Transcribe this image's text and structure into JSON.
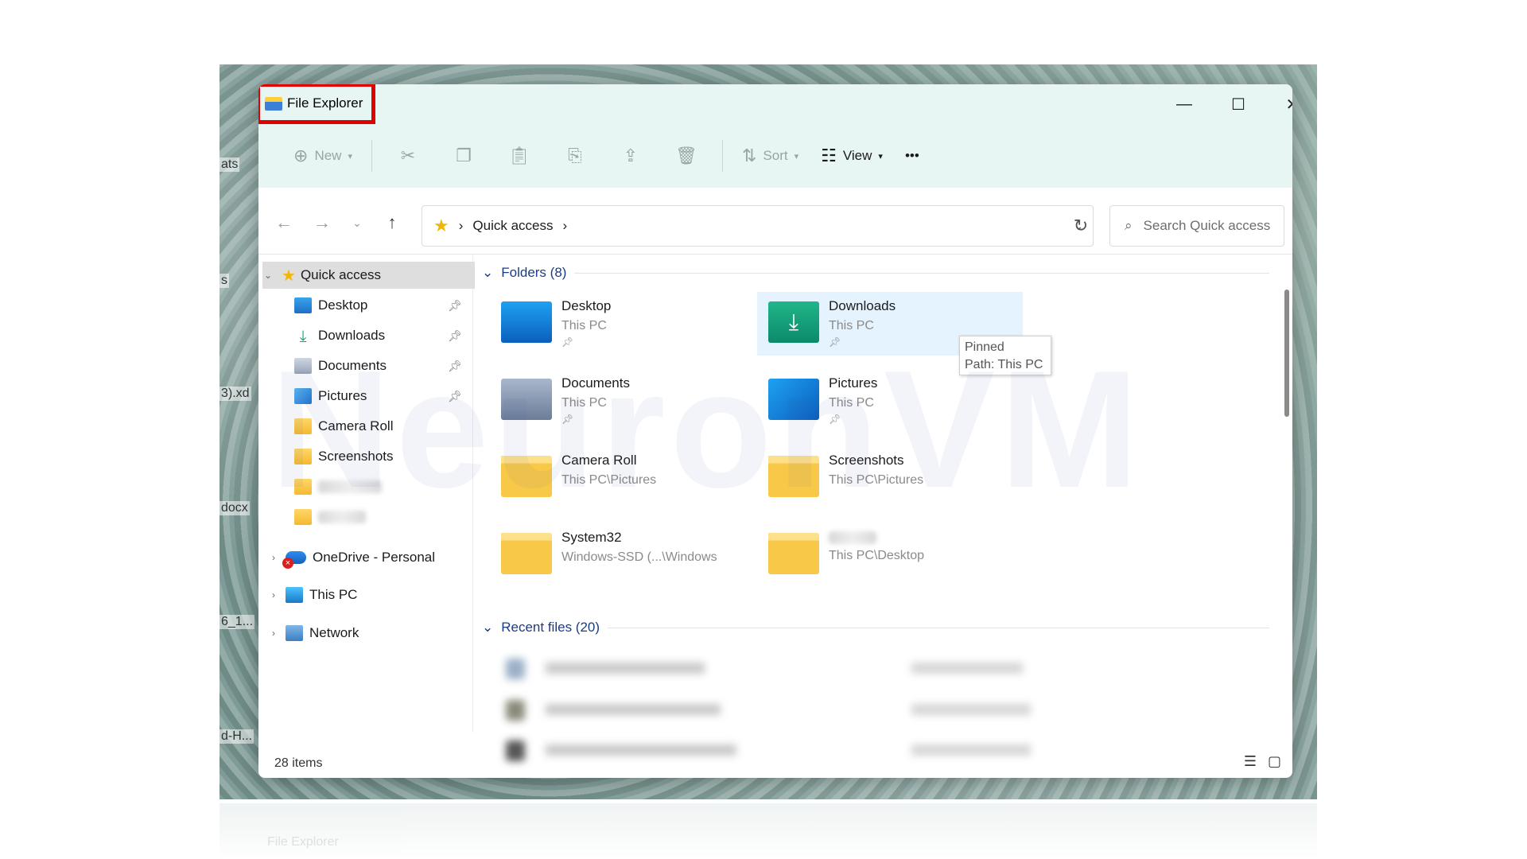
{
  "window": {
    "title": "File Explorer",
    "controls": {
      "minimize": "—",
      "maximize": "☐",
      "close": "✕"
    }
  },
  "toolbar": {
    "new_label": "New",
    "sort_label": "Sort",
    "view_label": "View",
    "more_label": "•••"
  },
  "address": {
    "path_label": "Quick access",
    "search_placeholder": "Search Quick access"
  },
  "sidebar": {
    "quick_access": "Quick access",
    "items": [
      {
        "label": "Desktop",
        "pinned": true
      },
      {
        "label": "Downloads",
        "pinned": true
      },
      {
        "label": "Documents",
        "pinned": true
      },
      {
        "label": "Pictures",
        "pinned": true
      },
      {
        "label": "Camera Roll",
        "pinned": false
      },
      {
        "label": "Screenshots",
        "pinned": false
      }
    ],
    "onedrive": "OneDrive - Personal",
    "this_pc": "This PC",
    "network": "Network"
  },
  "folders_section": {
    "header": "Folders (8)",
    "tiles": [
      {
        "name": "Desktop",
        "location": "This PC",
        "pinned": true
      },
      {
        "name": "Downloads",
        "location": "This PC",
        "pinned": true
      },
      {
        "name": "Documents",
        "location": "This PC",
        "pinned": true
      },
      {
        "name": "Pictures",
        "location": "This PC",
        "pinned": true
      },
      {
        "name": "Camera Roll",
        "location": "This PC\\Pictures"
      },
      {
        "name": "Screenshots",
        "location": "This PC\\Pictures"
      },
      {
        "name": "System32",
        "location": "Windows-SSD (...\\Windows"
      },
      {
        "name": "",
        "location": "This PC\\Desktop"
      }
    ]
  },
  "tooltip": {
    "line1": "Pinned",
    "line2": "Path: This PC"
  },
  "recent_section": {
    "header": "Recent files (20)"
  },
  "status": {
    "item_count": "28 items"
  },
  "desktop_fragments": [
    "ats",
    "s",
    "3).xd",
    "docx",
    "6_1...",
    "d-H..."
  ],
  "watermark": "NeuronVM",
  "reflection_text": "File Explorer",
  "colors": {
    "titlebar_bg": "#e7f6f2",
    "highlight_border": "#e00000",
    "section_header": "#1a3c86",
    "hover_tile": "#e5f3ff"
  }
}
